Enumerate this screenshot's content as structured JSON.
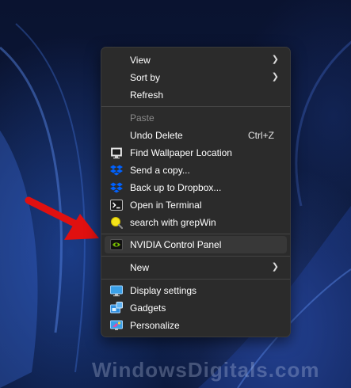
{
  "menu": {
    "items": [
      {
        "label": "View",
        "submenu": true
      },
      {
        "label": "Sort by",
        "submenu": true
      },
      {
        "label": "Refresh"
      },
      {
        "label": "Paste",
        "disabled": true
      },
      {
        "label": "Undo Delete",
        "shortcut": "Ctrl+Z"
      },
      {
        "label": "Find Wallpaper Location",
        "icon": "monitor-icon"
      },
      {
        "label": "Send a copy...",
        "icon": "dropbox-icon"
      },
      {
        "label": "Back up to Dropbox...",
        "icon": "dropbox-icon"
      },
      {
        "label": "Open in Terminal",
        "icon": "terminal-icon"
      },
      {
        "label": "search with grepWin",
        "icon": "magnifier-icon"
      },
      {
        "label": "NVIDIA Control Panel",
        "icon": "nvidia-icon",
        "highlighted": true
      },
      {
        "label": "New",
        "submenu": true
      },
      {
        "label": "Display settings",
        "icon": "display-settings-icon"
      },
      {
        "label": "Gadgets",
        "icon": "gadgets-icon"
      },
      {
        "label": "Personalize",
        "icon": "personalize-icon"
      }
    ]
  },
  "colors": {
    "menu_bg": "#2b2b2b",
    "highlight": "#383838",
    "arrow_red": "#e01010",
    "dropbox_blue": "#0061fe",
    "nvidia_green": "#76b900"
  },
  "watermark": "WindowsDigitals.com"
}
